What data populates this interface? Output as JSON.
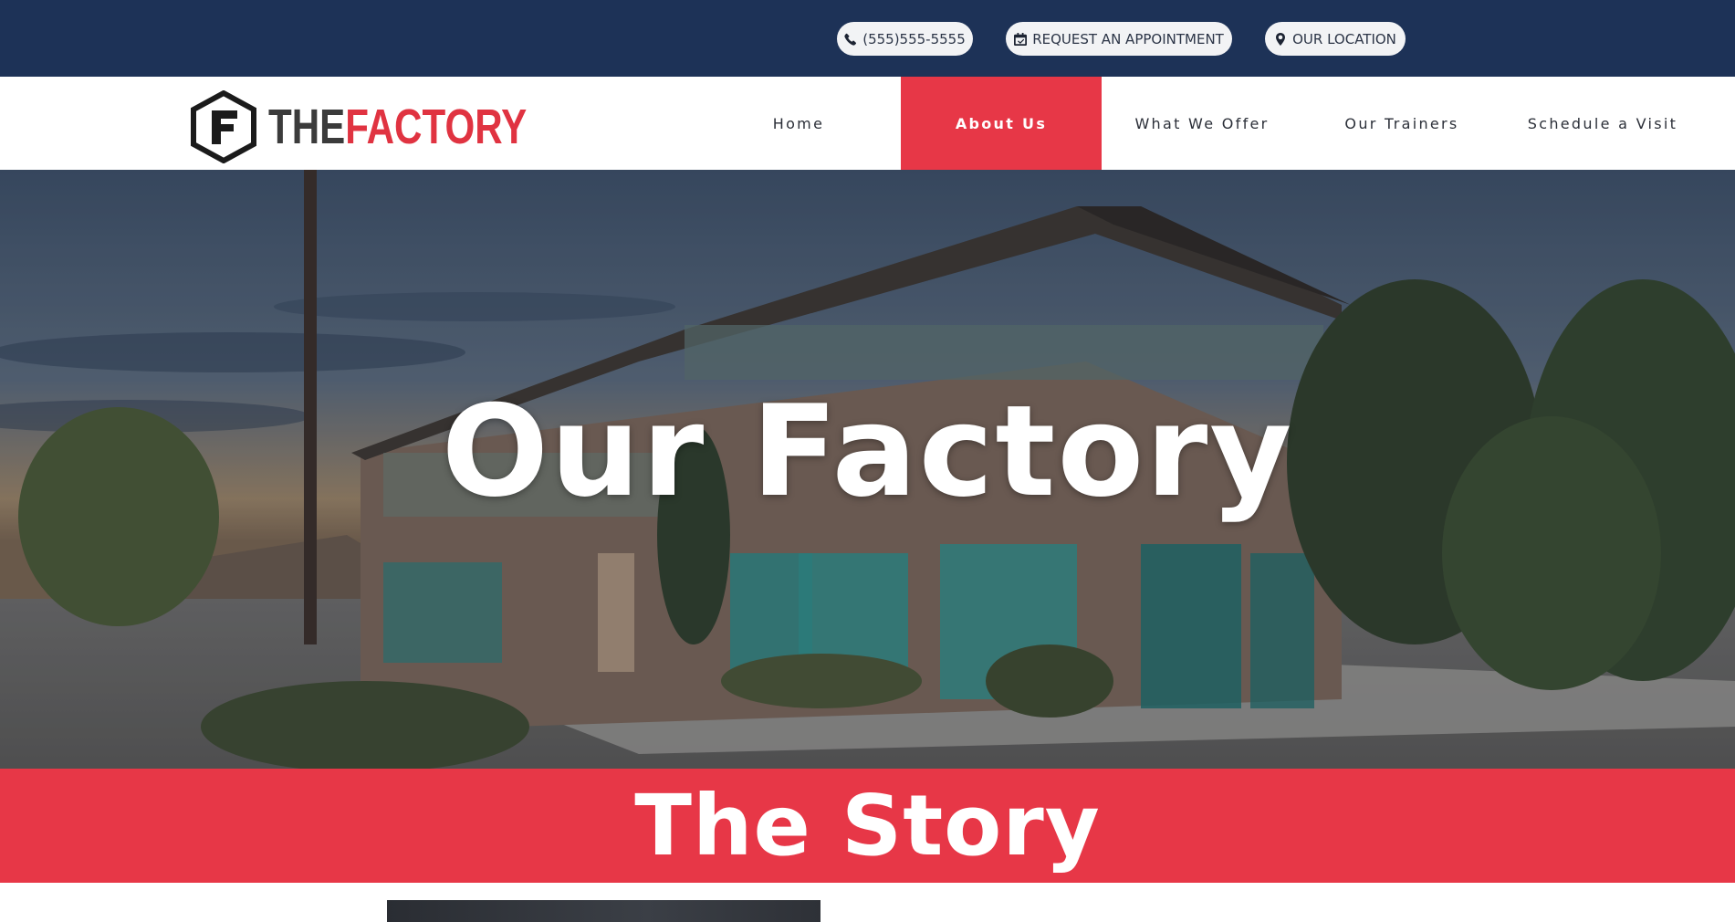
{
  "topbar": {
    "phone": {
      "label": "(555)555-5555",
      "icon": "phone-icon"
    },
    "appointment": {
      "label": "REQUEST AN APPOINTMENT",
      "icon": "calendar-check-icon"
    },
    "location": {
      "label": "OUR LOCATION",
      "icon": "map-marker-icon"
    }
  },
  "header": {
    "logo": {
      "the": "THE",
      "factory": "FACTORY",
      "mark": "F"
    },
    "nav": [
      {
        "label": "Home",
        "active": false
      },
      {
        "label": "About Us",
        "active": true
      },
      {
        "label": "What We Offer",
        "active": false
      },
      {
        "label": "Our Trainers",
        "active": false
      },
      {
        "label": "Schedule a Visit",
        "active": false
      }
    ]
  },
  "hero": {
    "title": "Our Factory"
  },
  "story": {
    "title": "The Story"
  },
  "colors": {
    "topbar": "#1d3257",
    "accent": "#e73747",
    "logo_red": "#e03341",
    "logo_dark": "#3b3b3b"
  }
}
